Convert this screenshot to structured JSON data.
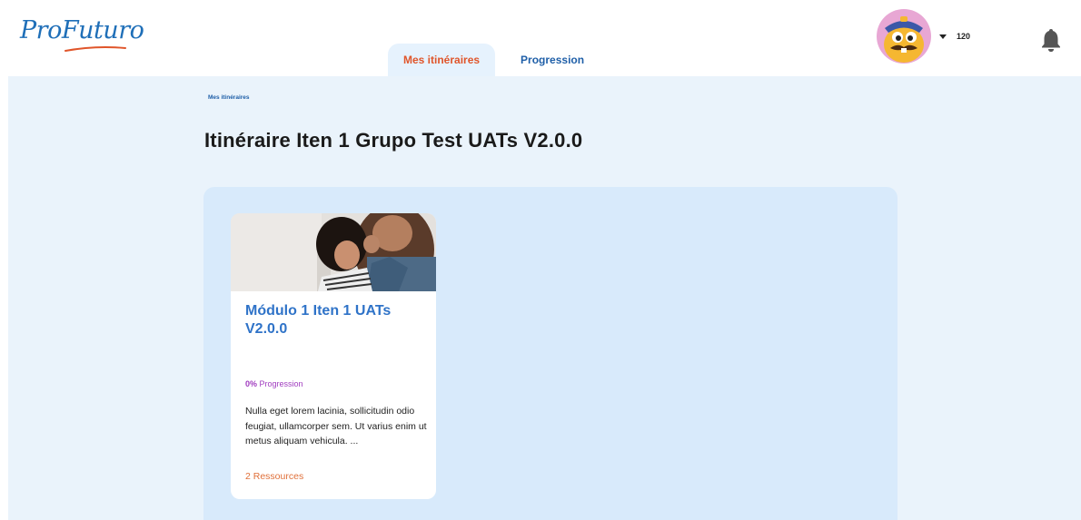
{
  "header": {
    "logo": "ProFuturo",
    "tabs": [
      {
        "label": "Mes itinéraires",
        "active": true
      },
      {
        "label": "Progression",
        "active": false
      }
    ],
    "points": "120",
    "accent_color": "#e0552a",
    "brand_color": "#1f6fb8"
  },
  "main": {
    "breadcrumb": "Mes itinéraires",
    "title": "Itinéraire Iten 1 Grupo Test UATs V2.0.0",
    "modules": [
      {
        "title": "Módulo 1 Iten 1 UATs V2.0.0",
        "progress_value": "0%",
        "progress_label": "Progression",
        "description": "Nulla eget lorem lacinia, sollicitudin odio feugiat, ullamcorper sem. Ut varius enim ut metus aliquam vehicula. ...",
        "resources": "2 Ressources"
      }
    ]
  },
  "icons": {
    "bell": "bell-icon",
    "caret": "caret-down-icon",
    "avatar": "monster-avatar"
  }
}
